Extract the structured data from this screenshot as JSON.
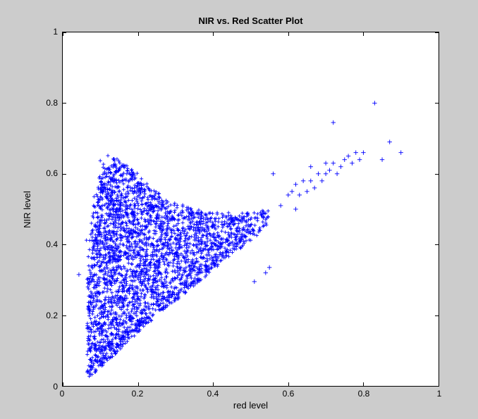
{
  "chart_data": {
    "type": "scatter",
    "title": "NIR vs. Red Scatter Plot",
    "xlabel": "red level",
    "ylabel": "NIR level",
    "xlim": [
      0,
      1
    ],
    "ylim": [
      0,
      1
    ],
    "xticks": [
      0,
      0.2,
      0.4,
      0.6,
      0.8,
      1
    ],
    "yticks": [
      0,
      0.2,
      0.4,
      0.6,
      0.8,
      1
    ],
    "marker": "+",
    "marker_color": "#0000ff",
    "data_description": "Dense scatter of several thousand + markers. Main cluster forms a roughly triangular / wedge-shaped region: lower vertex near (0.07, 0.02), left edge roughly vertical at x≈0.07–0.15 rising to y≈0.65, upper-left peak near (0.14, 0.65), then an upper boundary descending in a shallow U / swoosh to about (0.55, 0.50), while the lower boundary runs close to the diagonal y≈x from (0.07, 0.02) to (0.55, 0.50). A sparser tail of outliers extends upper-right along a band from (0.55, 0.50) up to about (0.9, 0.67) and a few isolated points near (0.72, 0.74), (0.83, 0.80).",
    "dense_region_polygon": [
      [
        0.065,
        0.02
      ],
      [
        0.065,
        0.35
      ],
      [
        0.08,
        0.5
      ],
      [
        0.1,
        0.6
      ],
      [
        0.14,
        0.65
      ],
      [
        0.2,
        0.6
      ],
      [
        0.25,
        0.55
      ],
      [
        0.3,
        0.52
      ],
      [
        0.35,
        0.5
      ],
      [
        0.42,
        0.49
      ],
      [
        0.5,
        0.49
      ],
      [
        0.55,
        0.5
      ],
      [
        0.52,
        0.45
      ],
      [
        0.45,
        0.38
      ],
      [
        0.38,
        0.31
      ],
      [
        0.3,
        0.24
      ],
      [
        0.22,
        0.17
      ],
      [
        0.15,
        0.1
      ],
      [
        0.1,
        0.05
      ]
    ],
    "sparse_outliers": [
      [
        0.043,
        0.315
      ],
      [
        0.085,
        0.14
      ],
      [
        0.51,
        0.295
      ],
      [
        0.54,
        0.32
      ],
      [
        0.55,
        0.335
      ],
      [
        0.56,
        0.6
      ],
      [
        0.58,
        0.51
      ],
      [
        0.6,
        0.54
      ],
      [
        0.61,
        0.55
      ],
      [
        0.62,
        0.5
      ],
      [
        0.62,
        0.57
      ],
      [
        0.63,
        0.54
      ],
      [
        0.64,
        0.58
      ],
      [
        0.65,
        0.55
      ],
      [
        0.66,
        0.58
      ],
      [
        0.66,
        0.62
      ],
      [
        0.67,
        0.56
      ],
      [
        0.68,
        0.6
      ],
      [
        0.69,
        0.58
      ],
      [
        0.7,
        0.6
      ],
      [
        0.7,
        0.63
      ],
      [
        0.71,
        0.61
      ],
      [
        0.72,
        0.63
      ],
      [
        0.72,
        0.745
      ],
      [
        0.73,
        0.6
      ],
      [
        0.74,
        0.62
      ],
      [
        0.75,
        0.64
      ],
      [
        0.76,
        0.65
      ],
      [
        0.77,
        0.63
      ],
      [
        0.78,
        0.66
      ],
      [
        0.79,
        0.64
      ],
      [
        0.8,
        0.66
      ],
      [
        0.83,
        0.8
      ],
      [
        0.85,
        0.64
      ],
      [
        0.87,
        0.69
      ],
      [
        0.9,
        0.66
      ]
    ]
  }
}
